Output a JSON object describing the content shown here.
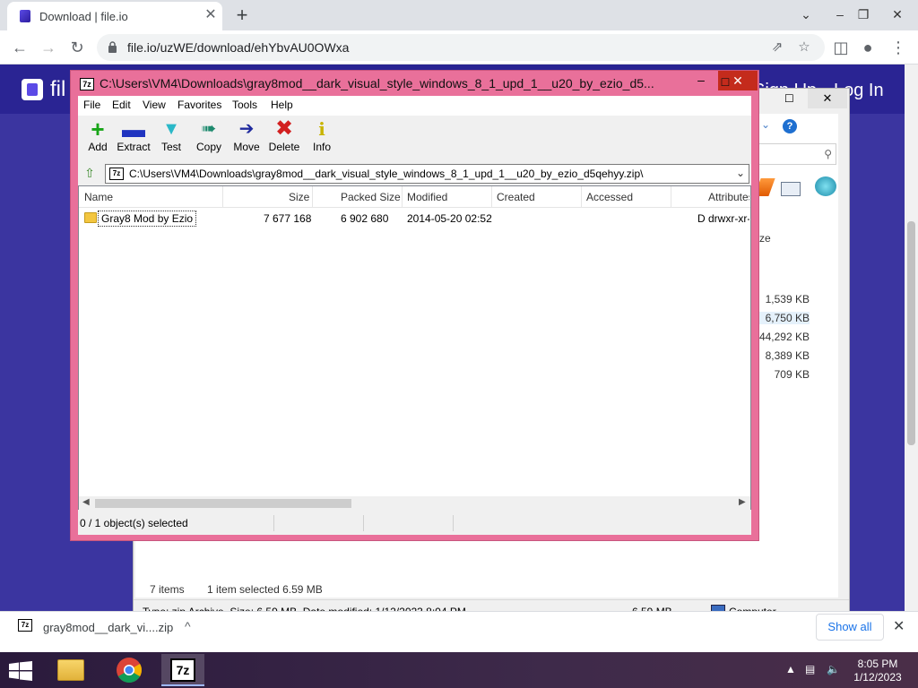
{
  "browser": {
    "tab_title": "Download | file.io",
    "tab_close": "✕",
    "new_tab": "+",
    "url": "file.io/uzWE/download/ehYbvAU0OWxa",
    "window_controls": {
      "minimize": "⌄",
      "restore": "–",
      "maximize": "❐",
      "close": "✕"
    }
  },
  "site": {
    "brand": "fil",
    "signup": "Sign Up",
    "login": "Log In"
  },
  "explorer": {
    "sizes": [
      "1,539 KB",
      "6,750 KB",
      "44,292 KB",
      "8,389 KB",
      "709 KB"
    ],
    "ze_fragment": "ze",
    "items_count": "7 items",
    "selection": "1 item selected  6.59 MB",
    "status_type": "Type: zip Archive, Size: 6.59 MB, Date modified: 1/12/2023 8:04 PM",
    "status_size": "6.59 MB",
    "status_location": "Computer"
  },
  "sevenzip": {
    "title": "C:\\Users\\VM4\\Downloads\\gray8mod__dark_visual_style_windows_8_1_upd_1__u20_by_ezio_d5...",
    "icon_label": "7z",
    "menu": [
      "File",
      "Edit",
      "View",
      "Favorites",
      "Tools",
      "Help"
    ],
    "tools": [
      {
        "label": "Add",
        "icon": "add-icon",
        "color": "#18a518"
      },
      {
        "label": "Extract",
        "icon": "extract-icon",
        "color": "#2034c0"
      },
      {
        "label": "Test",
        "icon": "test-icon",
        "color": "#2bb8c8"
      },
      {
        "label": "Copy",
        "icon": "copy-icon",
        "color": "#1d8a6e"
      },
      {
        "label": "Move",
        "icon": "move-icon",
        "color": "#1f2a9e"
      },
      {
        "label": "Delete",
        "icon": "delete-icon",
        "color": "#d21f1f"
      },
      {
        "label": "Info",
        "icon": "info-icon",
        "color": "#c8b400"
      }
    ],
    "path": "C:\\Users\\VM4\\Downloads\\gray8mod__dark_visual_style_windows_8_1_upd_1__u20_by_ezio_d5qehyy.zip\\",
    "columns": [
      "Name",
      "Size",
      "Packed Size",
      "Modified",
      "Created",
      "Accessed",
      "Attributes"
    ],
    "rows": [
      {
        "name": "Gray8 Mod by Ezio",
        "size": "7 677 168",
        "packed": "6 902 680",
        "modified": "2014-05-20 02:52",
        "created": "",
        "accessed": "",
        "attributes": "D drwxr-xr-"
      }
    ],
    "status": "0 / 1 object(s) selected"
  },
  "download_bar": {
    "file_name": "gray8mod__dark_vi....zip",
    "caret": "^",
    "show_all": "Show all",
    "close": "✕"
  },
  "taskbar": {
    "time": "8:05 PM",
    "date": "1/12/2023",
    "apps": [
      "file-explorer",
      "chrome",
      "7-zip"
    ]
  }
}
